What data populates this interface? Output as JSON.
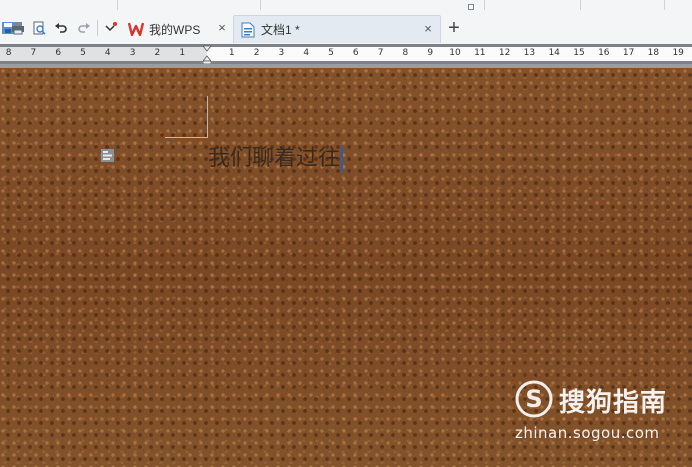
{
  "tabs": {
    "home": {
      "label": "我的WPS"
    },
    "document": {
      "label": "文档1 *"
    },
    "new_tab_symbol": "+",
    "close_symbol": "×"
  },
  "quick_access": [
    "save-icon",
    "print-icon",
    "print-preview-icon",
    "undo-icon",
    "redo-icon",
    "customize-icon"
  ],
  "ruler": {
    "left_numbers": [
      "8",
      "7",
      "6",
      "5",
      "4",
      "3",
      "2",
      "1"
    ],
    "right_numbers": [
      "1",
      "2",
      "3",
      "4",
      "5",
      "6",
      "7",
      "8",
      "9",
      "10",
      "11",
      "12",
      "13",
      "14",
      "15",
      "16",
      "17",
      "18",
      "19"
    ]
  },
  "document": {
    "text": "我们聊着过往",
    "background": "brown-leather-texture"
  },
  "watermark": {
    "brand": "搜狗指南",
    "url": "zhinan.sogou.com"
  },
  "colors": {
    "accent": "#1f5fbf",
    "wps_red": "#d9342b",
    "leather": "#7b4a24"
  }
}
